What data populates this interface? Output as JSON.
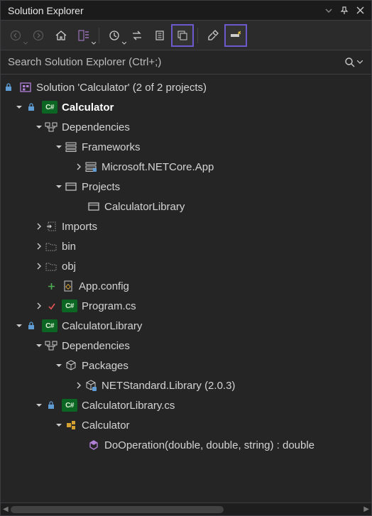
{
  "panel": {
    "title": "Solution Explorer"
  },
  "search": {
    "placeholder": "Search Solution Explorer (Ctrl+;)"
  },
  "tree": {
    "solution": "Solution 'Calculator' (2 of 2 projects)",
    "proj1": "Calculator",
    "proj1_dep": "Dependencies",
    "proj1_fw": "Frameworks",
    "proj1_fw_item": "Microsoft.NETCore.App",
    "proj1_projects": "Projects",
    "proj1_projects_item": "CalculatorLibrary",
    "proj1_imports": "Imports",
    "proj1_bin": "bin",
    "proj1_obj": "obj",
    "proj1_appconfig": "App.config",
    "proj1_program": "Program.cs",
    "proj2": "CalculatorLibrary",
    "proj2_dep": "Dependencies",
    "proj2_pkg": "Packages",
    "proj2_pkg_item": "NETStandard.Library (2.0.3)",
    "proj2_file": "CalculatorLibrary.cs",
    "proj2_class": "Calculator",
    "proj2_method": "DoOperation(double, double, string) : double"
  }
}
